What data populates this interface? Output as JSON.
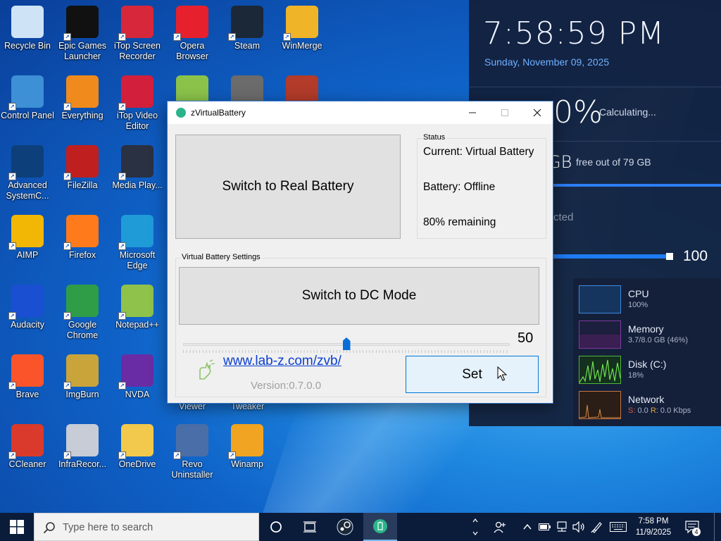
{
  "desktop_icons": [
    {
      "label": "Recycle Bin",
      "icon": "recycle-bin-icon",
      "color": "#cfe3f7"
    },
    {
      "label": "Epic Games Launcher",
      "icon": "epic-games-icon",
      "color": "#111111"
    },
    {
      "label": "iTop Screen Recorder",
      "icon": "itop-recorder-icon",
      "color": "#d6283a"
    },
    {
      "label": "Opera Browser",
      "icon": "opera-icon",
      "color": "#e6202c"
    },
    {
      "label": "Steam",
      "icon": "steam-icon",
      "color": "#1b2838"
    },
    {
      "label": "WinMerge",
      "icon": "winmerge-icon",
      "color": "#f0b429"
    },
    {
      "label": "Control Panel",
      "icon": "control-panel-icon",
      "color": "#3d8fd6"
    },
    {
      "label": "Everything",
      "icon": "everything-icon",
      "color": "#f08a1c"
    },
    {
      "label": "iTop Video Editor",
      "icon": "itop-video-icon",
      "color": "#d21f3c"
    },
    {
      "label": "Advanced SystemC...",
      "icon": "advanced-systemcare-icon",
      "color": "#0d3f7a"
    },
    {
      "label": "FileZilla",
      "icon": "filezilla-icon",
      "color": "#bf1f1f"
    },
    {
      "label": "Media Play...",
      "icon": "media-player-icon",
      "color": "#2a3142"
    },
    {
      "label": "AIMP",
      "icon": "aimp-icon",
      "color": "#f2b705"
    },
    {
      "label": "Firefox",
      "icon": "firefox-icon",
      "color": "#ff7a1a"
    },
    {
      "label": "Microsoft Edge",
      "icon": "edge-icon",
      "color": "#1f9cd8"
    },
    {
      "label": "Audacity",
      "icon": "audacity-icon",
      "color": "#1a4fd1"
    },
    {
      "label": "Google Chrome",
      "icon": "chrome-icon",
      "color": "#2f9d48"
    },
    {
      "label": "Notepad++",
      "icon": "notepadpp-icon",
      "color": "#8fc24a"
    },
    {
      "label": "Brave",
      "icon": "brave-icon",
      "color": "#fb542b"
    },
    {
      "label": "ImgBurn",
      "icon": "imgburn-icon",
      "color": "#c9a43a"
    },
    {
      "label": "NVDA",
      "icon": "nvda-icon",
      "color": "#6a2ca5"
    },
    {
      "label": "CCleaner",
      "icon": "ccleaner-icon",
      "color": "#d93a2b"
    },
    {
      "label": "InfraRecor...",
      "icon": "infrarecorder-icon",
      "color": "#c7ccd6"
    },
    {
      "label": "OneDrive",
      "icon": "onedrive-icon",
      "color": "#f2c94c"
    },
    {
      "label": "Revo Uninstaller",
      "icon": "revo-uninstaller-icon",
      "color": "#4a6ea8"
    },
    {
      "label": "Winamp",
      "icon": "winamp-icon",
      "color": "#f1a422"
    }
  ],
  "partial_icons": [
    {
      "label": "Viewer"
    },
    {
      "label": "Tweaker"
    }
  ],
  "widget": {
    "time": "7:58:59 PM",
    "date": "Sunday, November 09, 2025",
    "battery_pct_partial": "0%",
    "battery_status": "Calculating...",
    "disk_partial": "GB",
    "disk_free": "free out of 79 GB",
    "network_partial": "cted",
    "slider_value": "100",
    "perf": [
      {
        "name": "CPU",
        "sub": "100%",
        "color": "#3b8be0"
      },
      {
        "name": "Memory",
        "sub": "3.7/8.0 GB (46%)",
        "color": "#9b3fc2"
      },
      {
        "name": "Disk (C:)",
        "sub": "18%",
        "color": "#4fb83a"
      },
      {
        "name": "Network",
        "sub_s_label": "S:",
        "sub_s": "0.0",
        "sub_r_label": "R:",
        "sub_r": "0.0 Kbps",
        "color": "#c8743a"
      }
    ]
  },
  "app": {
    "title": "zVirtualBattery",
    "switch_real_label": "Switch to Real Battery",
    "status_legend": "Status",
    "status_current": "Current: Virtual Battery",
    "status_battery": "Battery: Offline",
    "status_remaining": "80% remaining",
    "settings_legend": "Virtual Battery Settings",
    "dc_mode_label": "Switch to DC Mode",
    "slider_value": "50",
    "slider_max": 100,
    "link": "www.lab-z.com/zvb/",
    "version": "Version:0.7.0.0",
    "set_label": "Set"
  },
  "taskbar": {
    "search_placeholder": "Type here to search",
    "time": "7:58 PM",
    "date": "11/9/2025",
    "notification_count": "4"
  }
}
